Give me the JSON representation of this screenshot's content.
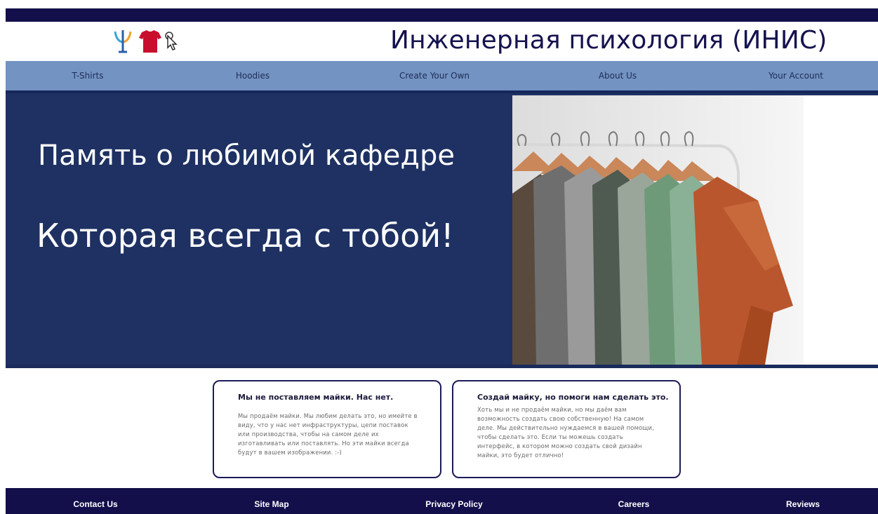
{
  "header": {
    "title": "Инженерная психология (ИНИС)",
    "logo_icons": [
      "psi-icon",
      "tshirt-icon",
      "cursor-click-icon"
    ]
  },
  "nav": {
    "items": [
      {
        "label": "T-Shirts"
      },
      {
        "label": "Hoodies"
      },
      {
        "label": "Create Your Own"
      },
      {
        "label": "About Us"
      },
      {
        "label": "Your Account"
      }
    ]
  },
  "hero": {
    "line1": "Память о любимой кафедре",
    "line2": "Которая всегда с тобой!",
    "image_icon": "clothes-rack-image"
  },
  "cards": [
    {
      "title": "Мы не поставляем майки. Нас нет.",
      "body": "Мы продаём майки. Мы любим делать это, но имейте в виду, что у нас нет инфраструктуры, цепи поставок или производства, чтобы на самом деле их изготавливать или поставлять. Но эти майки всегда будут в вашем изображении. :-)"
    },
    {
      "title": "Создай майку, но помоги нам сделать это.",
      "body": "Хоть мы и не продаём майки, но мы даём вам возможность создать свою собственную! На самом деле. Мы действительно нуждаемся в вашей помощи, чтобы сделать это. Если ты можешь создать интерфейс, в котором можно создать свой дизайн майки, это будет отлично!"
    }
  ],
  "footer": {
    "links": [
      {
        "label": "Contact Us"
      },
      {
        "label": "Site Map"
      },
      {
        "label": "Privacy Policy"
      },
      {
        "label": "Careers"
      },
      {
        "label": "Reviews"
      }
    ]
  },
  "colors": {
    "dark_navy": "#120f4a",
    "nav_blue": "#7393c2",
    "hero_blue": "#1e3162",
    "title_color": "#15124f",
    "logo_red": "#c8102e"
  }
}
